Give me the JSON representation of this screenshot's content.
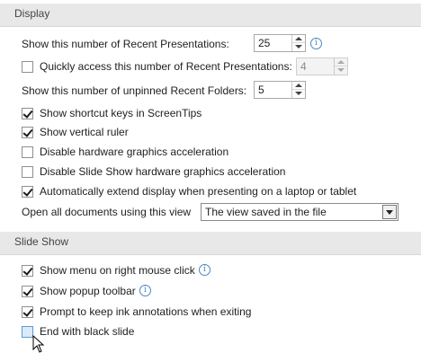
{
  "display": {
    "header": "Display",
    "recent_presentations": {
      "label": "Show this number of Recent Presentations:",
      "value": "25"
    },
    "quick_access": {
      "label": "Quickly access this number of Recent Presentations:",
      "value": "4",
      "checked": false
    },
    "unpinned_folders": {
      "label": "Show this number of unpinned Recent Folders:",
      "value": "5"
    },
    "checkboxes": [
      {
        "label": "Show shortcut keys in ScreenTips",
        "checked": true
      },
      {
        "label": "Show vertical ruler",
        "checked": true
      },
      {
        "label": "Disable hardware graphics acceleration",
        "checked": false
      },
      {
        "label": "Disable Slide Show hardware graphics acceleration",
        "checked": false
      },
      {
        "label": "Automatically extend display when presenting on a laptop or tablet",
        "checked": true
      }
    ],
    "open_view": {
      "label": "Open all documents using this view",
      "value": "The view saved in the file"
    }
  },
  "slideshow": {
    "header": "Slide Show",
    "checkboxes": [
      {
        "label": "Show menu on right mouse click",
        "checked": true,
        "info": true
      },
      {
        "label": "Show popup toolbar",
        "checked": true,
        "info": true
      },
      {
        "label": "Prompt to keep ink annotations when exiting",
        "checked": true
      },
      {
        "label": "End with black slide",
        "checked": false
      }
    ]
  },
  "icons": {
    "info": "info-icon",
    "cursor": "mouse-pointer-icon"
  }
}
